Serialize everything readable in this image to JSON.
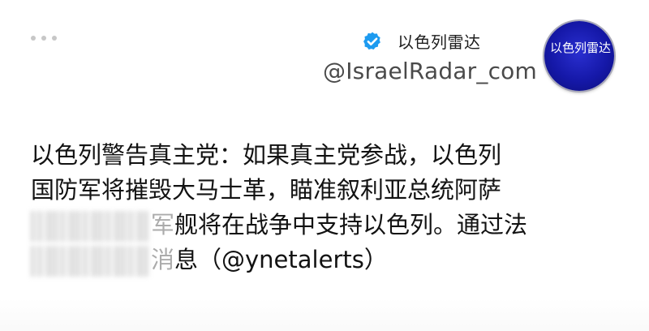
{
  "header": {
    "display_name": "以色列雷达",
    "handle": "@IsraelRadar_com",
    "avatar_text": "以色列雷达",
    "verified": true,
    "more_icon": "more-horizontal-icon",
    "verified_icon": "verified-badge-icon"
  },
  "post": {
    "lines": [
      "以色列警告真主党：如果真主党参战，以色列",
      "国防军将摧毁大马士革，瞄准叙利亚总统阿萨",
      "舰将在战争中支持以色列。通过法",
      "息（@ynetalerts）"
    ],
    "line3_visible_prefix": "军",
    "line4_visible_prefix": "消"
  },
  "colors": {
    "avatar_blue": "#1518a8",
    "verified_blue": "#1d9bf0",
    "text": "#121212",
    "handle_gray": "#4a4a4a"
  }
}
